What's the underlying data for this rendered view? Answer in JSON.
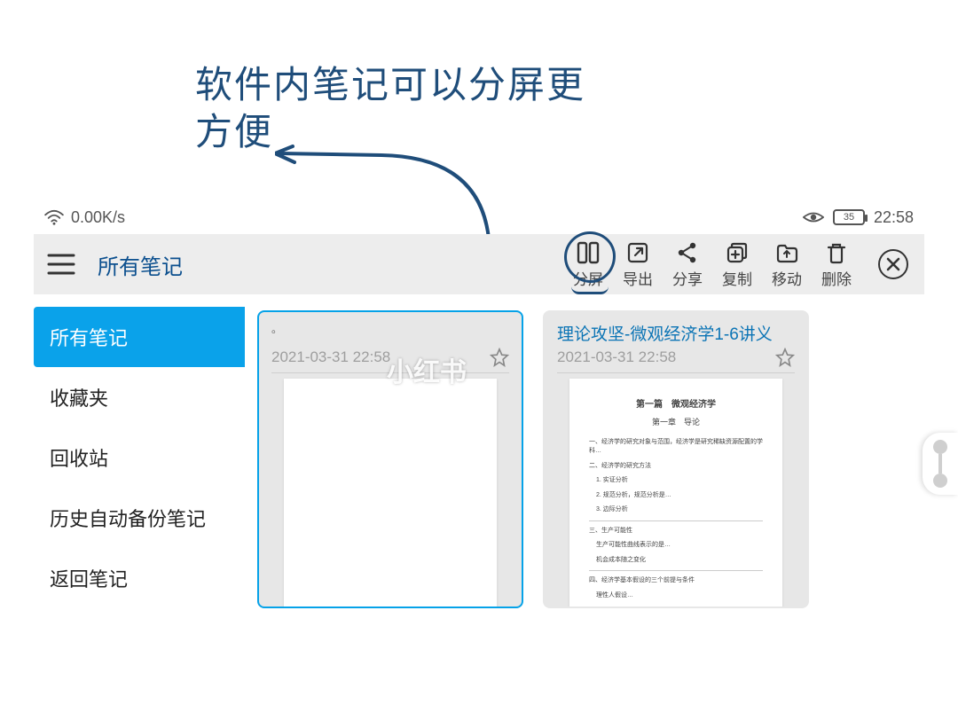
{
  "annotation": {
    "line1": "软件内笔记可以分屏更",
    "line2": "方便"
  },
  "statusbar": {
    "speed": "0.00K/s",
    "battery": "35",
    "time": "22:58"
  },
  "toolbar": {
    "title": "所有笔记",
    "actions": {
      "split": "分屏",
      "export": "导出",
      "share": "分享",
      "copy": "复制",
      "move": "移动",
      "delete": "删除"
    }
  },
  "sidebar": {
    "items": [
      "所有笔记",
      "收藏夹",
      "回收站",
      "历史自动备份笔记",
      "返回笔记"
    ]
  },
  "cards": [
    {
      "title": "。",
      "timestamp": "2021-03-31 22:58"
    },
    {
      "title": "理论攻坚-微观经济学1-6讲义",
      "timestamp": "2021-03-31 22:58",
      "doc_title": "第一篇　微观经济学",
      "doc_subtitle": "第一章　导论"
    }
  ],
  "watermark": "小红书"
}
